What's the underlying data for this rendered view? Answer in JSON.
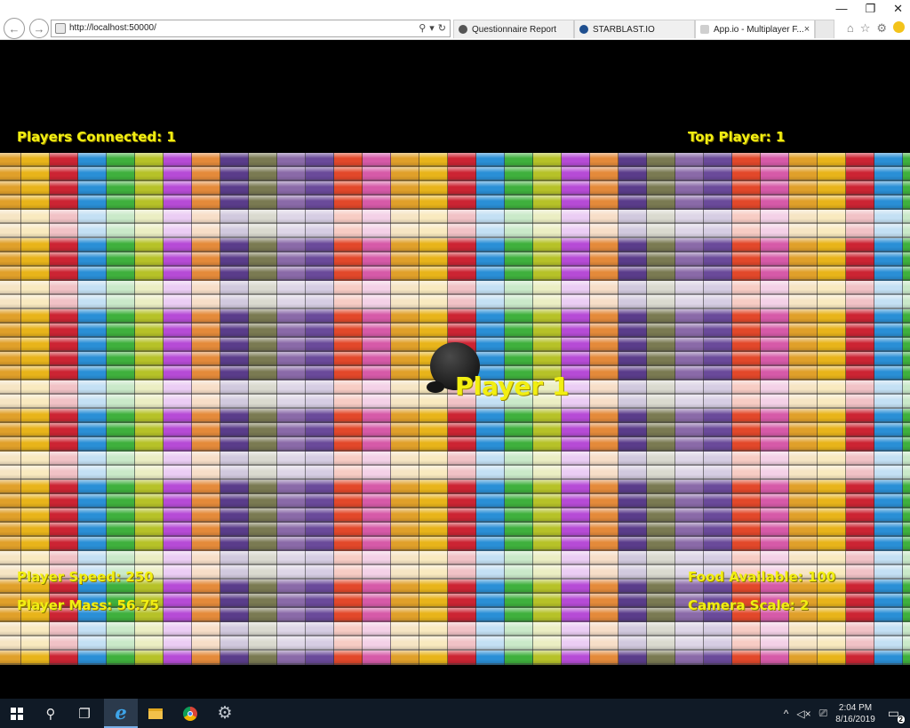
{
  "browser": {
    "url": "http://localhost:50000/",
    "tabs": [
      {
        "label": "Questionnaire Report",
        "active": false
      },
      {
        "label": "STARBLAST.IO",
        "active": false
      },
      {
        "label": "App.io - Multiplayer F...",
        "active": true
      }
    ],
    "tab_close": "×",
    "window_controls": {
      "minimize": "—",
      "restore": "❐",
      "close": "✕"
    }
  },
  "game": {
    "hud": {
      "players_connected": "Players Connected: 1",
      "top_player": "Top Player: 1",
      "player_speed": "Player Speed: 250",
      "player_mass": "Player Mass: 56.75",
      "food_available": "Food Available: 100",
      "camera_scale": "Camera Scale: 2"
    },
    "player_name": "Player 1",
    "hud_color": "#f2ef12"
  },
  "taskbar": {
    "clock_time": "2:04 PM",
    "clock_date": "8/16/2019",
    "notification_count": "2",
    "icons": [
      "windows-start",
      "search",
      "task-view",
      "internet-explorer",
      "file-explorer",
      "chrome",
      "settings"
    ]
  }
}
